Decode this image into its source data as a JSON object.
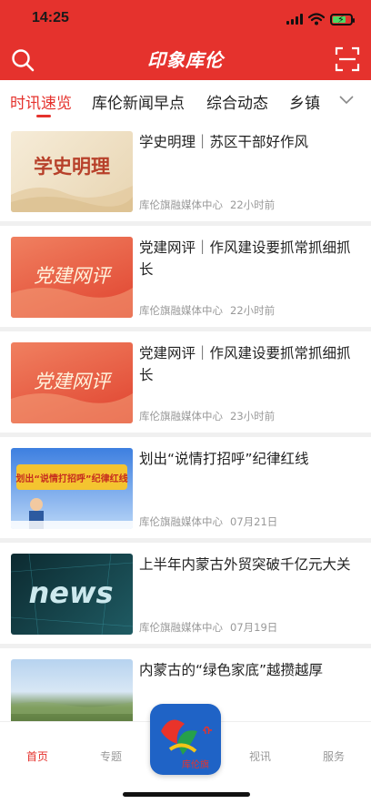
{
  "status_bar": {
    "time": "14:25"
  },
  "header": {
    "title": "印象库伦"
  },
  "tabs": [
    {
      "label": "时讯速览",
      "active": true
    },
    {
      "label": "库伦新闻早点",
      "active": false
    },
    {
      "label": "综合动态",
      "active": false
    },
    {
      "label": "乡镇",
      "active": false
    }
  ],
  "icons": {
    "search": "search-icon",
    "scan": "scan-icon",
    "more_tabs": "chevron-down-icon"
  },
  "feed": [
    {
      "title": "学史明理｜苏区干部好作风",
      "source": "库伦旗融媒体中心",
      "time": "22小时前",
      "thumb_text": "学史明理"
    },
    {
      "title": "党建网评｜作风建设要抓常抓细抓长",
      "source": "库伦旗融媒体中心",
      "time": "22小时前",
      "thumb_text": "党建网评"
    },
    {
      "title": "党建网评｜作风建设要抓常抓细抓长",
      "source": "库伦旗融媒体中心",
      "time": "23小时前",
      "thumb_text": "党建网评"
    },
    {
      "title": "划出“说情打招呼”纪律红线",
      "source": "库伦旗融媒体中心",
      "time": "07月21日",
      "thumb_text": "划出“说情打招呼”纪律红线"
    },
    {
      "title": "上半年内蒙古外贸突破千亿元大关",
      "source": "库伦旗融媒体中心",
      "time": "07月19日",
      "thumb_text": "news"
    },
    {
      "title": "内蒙古的“绿色家底”越攒越厚",
      "source": "",
      "time": "",
      "thumb_text": ""
    }
  ],
  "bottom_nav": [
    {
      "label": "首页",
      "active": true
    },
    {
      "label": "专题",
      "active": false
    },
    {
      "label": "视讯",
      "active": false
    },
    {
      "label": "服务",
      "active": false
    }
  ],
  "center_logo": {
    "text": "库伦旗"
  },
  "colors": {
    "brand": "#e5322d",
    "meta": "#999999",
    "center_button": "#1f63c6"
  }
}
